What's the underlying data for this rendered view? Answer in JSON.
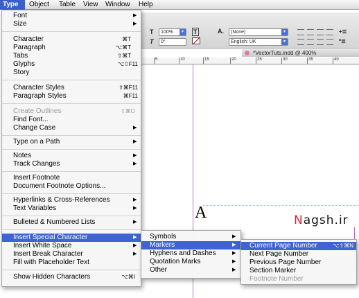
{
  "menubar": {
    "items": [
      "Type",
      "Object",
      "Table",
      "View",
      "Window",
      "Help"
    ]
  },
  "control_panel": {
    "tracking_value": "100%",
    "skew_value": "0°",
    "char_style": "(None)",
    "language": "English: UK"
  },
  "document": {
    "tab_title": "*VectorTuts.indd @ 400%",
    "ruler_ticks": [
      "5",
      "10",
      "15",
      "20",
      "25",
      "30",
      "35",
      "40"
    ],
    "sample_glyph": "A",
    "watermark_first": "N",
    "watermark_rest": "agsh.ir"
  },
  "type_menu": {
    "font": "Font",
    "size": "Size",
    "character": "Character",
    "character_sc": "⌘T",
    "paragraph": "Paragraph",
    "paragraph_sc": "⌥⌘T",
    "tabs": "Tabs",
    "tabs_sc": "⇧⌘T",
    "glyphs": "Glyphs",
    "glyphs_sc": "⌥⇧F11",
    "story": "Story",
    "character_styles": "Character Styles",
    "character_styles_sc": "⇧⌘F11",
    "paragraph_styles": "Paragraph Styles",
    "paragraph_styles_sc": "⌘F11",
    "create_outlines": "Create Outlines",
    "create_outlines_sc": "⇧⌘O",
    "find_font": "Find Font...",
    "change_case": "Change Case",
    "type_on_path": "Type on a Path",
    "notes": "Notes",
    "track_changes": "Track Changes",
    "insert_footnote": "Insert Footnote",
    "footnote_options": "Document Footnote Options...",
    "hyperlinks": "Hyperlinks & Cross-References",
    "text_variables": "Text Variables",
    "bulleted_lists": "Bulleted & Numbered Lists",
    "insert_special_char": "Insert Special Character",
    "insert_white_space": "Insert White Space",
    "insert_break_char": "Insert Break Character",
    "fill_placeholder": "Fill with Placeholder Text",
    "show_hidden": "Show Hidden Characters",
    "show_hidden_sc": "⌥⌘I"
  },
  "special_char_menu": {
    "symbols": "Symbols",
    "markers": "Markers",
    "hyphens_dashes": "Hyphens and Dashes",
    "quotation_marks": "Quotation Marks",
    "other": "Other"
  },
  "markers_menu": {
    "current_page": "Current Page Number",
    "current_page_sc": "⌥⇧⌘N",
    "next_page": "Next Page Number",
    "previous_page": "Previous Page Number",
    "section_marker": "Section Marker",
    "footnote_number": "Footnote Number"
  },
  "glyphs": {
    "submenu_arrow": "▶",
    "dropdown_arrow": "◆"
  },
  "colors": {
    "selection": "#3d64d1",
    "guide": "#b473c9",
    "watermark_accent": "#d7262f"
  }
}
